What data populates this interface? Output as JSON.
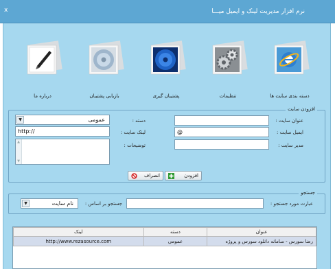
{
  "window": {
    "title": "نرم افزار مدیریت لینک و ایمیل میـــا",
    "close_glyph": "x"
  },
  "toolbar": {
    "items": [
      {
        "label": "دسته بندی سایت ها",
        "icon": "internet-explorer-icon"
      },
      {
        "label": "تنظیمات",
        "icon": "gears-icon"
      },
      {
        "label": "پشتیبان گیری",
        "icon": "cd-backup-icon"
      },
      {
        "label": "بازیابی پشتیبان",
        "icon": "cd-restore-icon"
      },
      {
        "label": "درباره ما",
        "icon": "pen-about-icon"
      }
    ]
  },
  "add_site": {
    "group_title": "افزودن سایت",
    "title_label": "عنوان سایت :",
    "title_value": "",
    "email_label": "ایمیل سایت :",
    "email_value": "@",
    "admin_label": "مدیر سایت :",
    "admin_value": "",
    "category_label": "دسته :",
    "category_value": "عمومی",
    "link_label": "لینک سایت :",
    "link_value": "http://",
    "desc_label": "توضیحات :",
    "desc_value": "",
    "add_button": "افزودن",
    "cancel_button": "انصراف"
  },
  "search": {
    "group_title": "جستجو",
    "phrase_label": "عبارت مورد جستجو :",
    "phrase_value": "",
    "by_label": "جستجو بر اساس :",
    "by_value": "نام سایت"
  },
  "table": {
    "headers": [
      "عنوان",
      "دسته",
      "لینک"
    ],
    "rows": [
      {
        "title": "رضا سورس - سامانه دانلود سورس و پروژه",
        "category": "عمومی",
        "link": "http://www.rezasource.com"
      }
    ]
  },
  "colors": {
    "titlebar": "#5da7d3",
    "client_bg": "#a6d8ef",
    "selected_row": "#d3dcec"
  }
}
